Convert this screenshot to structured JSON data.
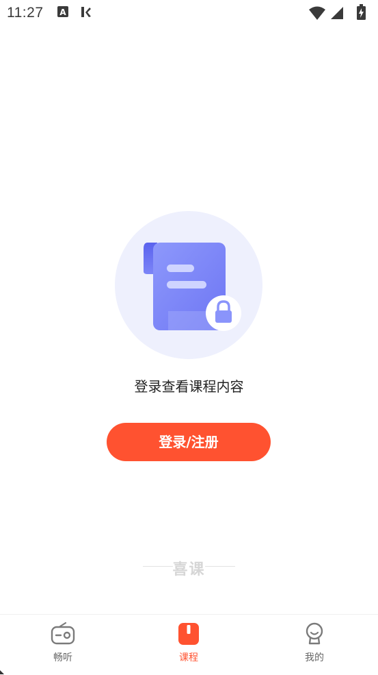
{
  "status_bar": {
    "time": "11:27"
  },
  "empty_state": {
    "message": "登录查看课程内容"
  },
  "login_button": {
    "label": "登录/注册"
  },
  "brand": {
    "name": "喜课"
  },
  "tabs": [
    {
      "label": "畅听",
      "icon": "radio-icon",
      "active": false
    },
    {
      "label": "课程",
      "icon": "book-icon",
      "active": true
    },
    {
      "label": "我的",
      "icon": "profile-icon",
      "active": false
    }
  ],
  "colors": {
    "accent": "#ff5230",
    "illustration": "#7b84fa",
    "illustration_bg": "#eef0fd"
  }
}
